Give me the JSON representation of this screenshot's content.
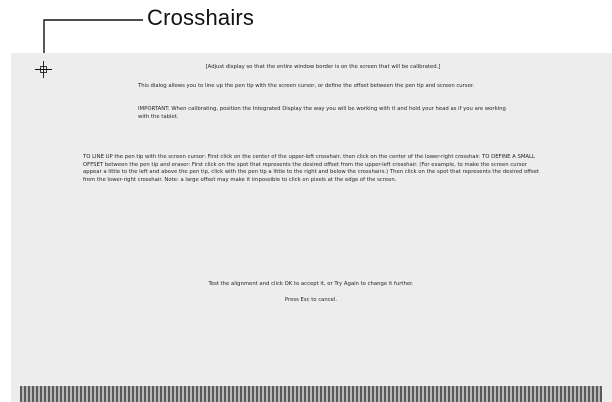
{
  "callout": {
    "label": "Crosshairs"
  },
  "dialog": {
    "adjust_note": "[Adjust display so that the entire window border is on the screen that will be calibrated.]",
    "intro": "This dialog allows you to line up the pen tip with the screen cursor, or define the offset between the pen tip and screen cursor.",
    "important": "IMPORTANT: When calibrating, position the Integrated Display the way you will be working with it and hold your head as if you are working with the tablet.",
    "instructions": "TO LINE UP the pen tip with the screen cursor: First click on the center of the upper-left crosshair, then click on the center of the lower-right crosshair. TO DEFINE A SMALL OFFSET between the pen tip and eraser: First click on the spot that represents the desired offset from the upper-left crosshair. (For example, to make the screen cursor appear a little to the left and above the pen tip, click with the pen tip a little to the right and below the crosshairs.) Then click on the spot that represents the desired offset from the lower-right crosshair. Note: a large offset may make it impossible to click on pixels at the edge of the screen.",
    "test_prompt": "Test the alignment and click OK to accept it, or Try Again to change it further.",
    "esc_prompt": "Press Esc to cancel."
  },
  "colors": {
    "dialog_background": "#ededed",
    "border_dark": "#5a5a5a",
    "border_light": "#b8b8b8"
  }
}
